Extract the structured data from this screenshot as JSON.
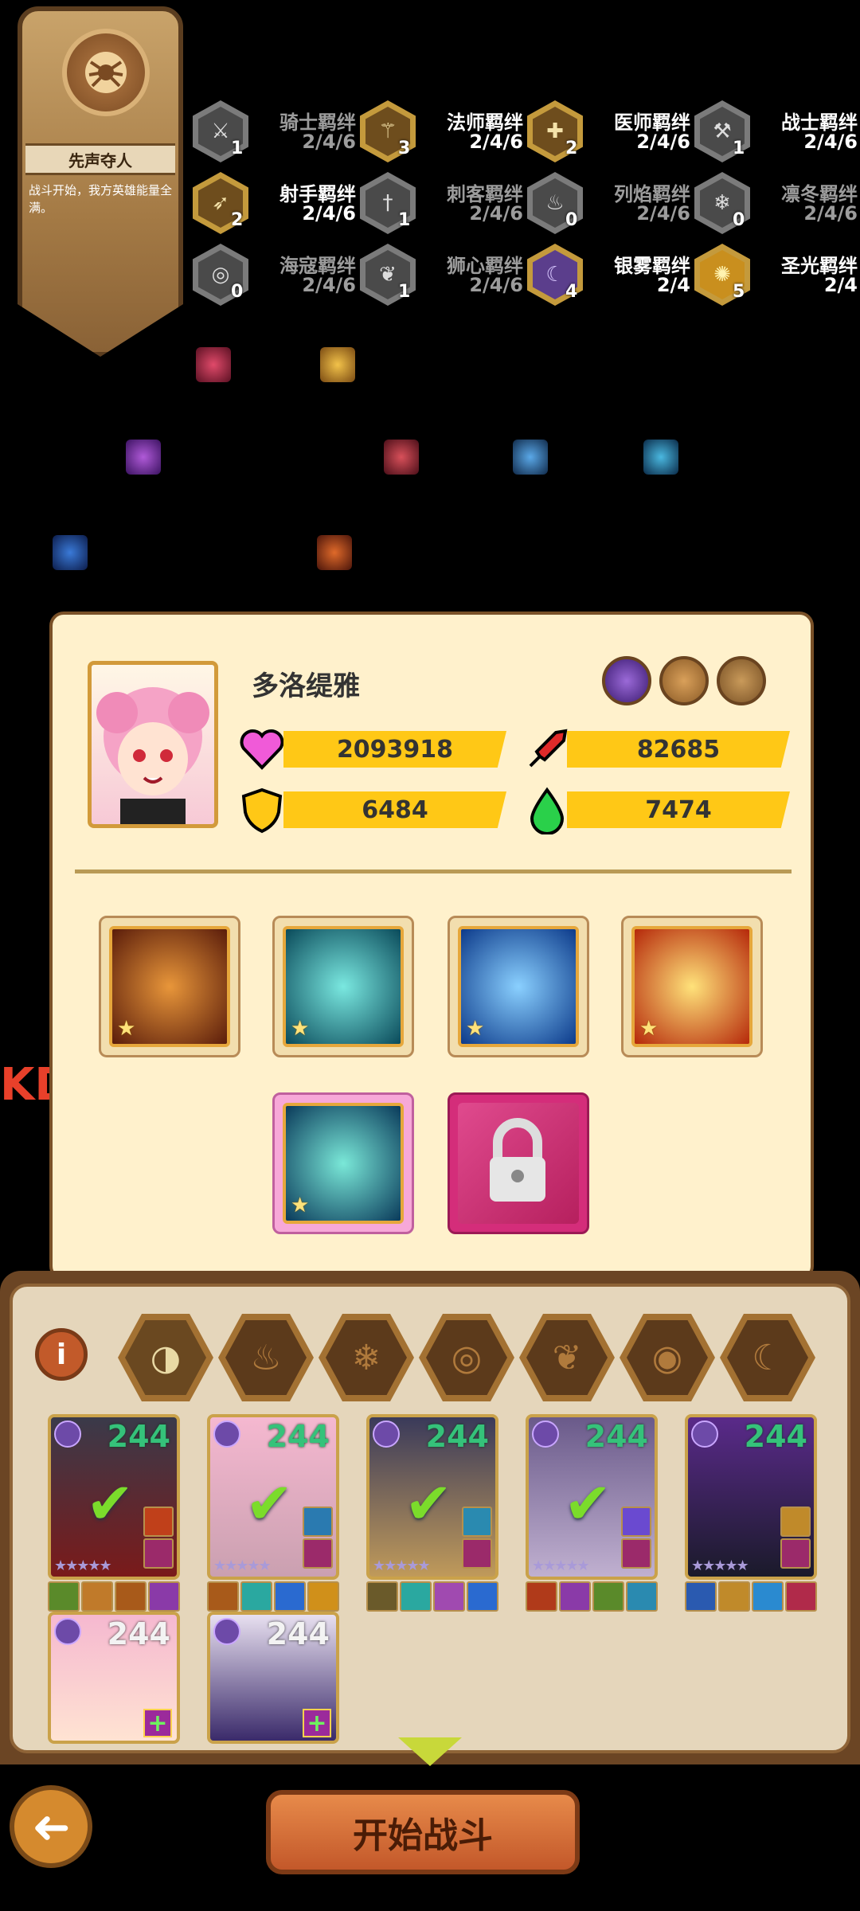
{
  "bond_card": {
    "title": "先声夺人",
    "description": "战斗开始，我方英雄能量全满。"
  },
  "bonds": [
    {
      "name": "骑士羁绊",
      "levels": "2/4/6",
      "count": "1",
      "active": false,
      "icon": "sword-icon"
    },
    {
      "name": "法师羁绊",
      "levels": "2/4/6",
      "count": "3",
      "active": true,
      "icon": "staff-icon"
    },
    {
      "name": "医师羁绊",
      "levels": "2/4/6",
      "count": "2",
      "active": true,
      "icon": "cross-icon"
    },
    {
      "name": "战士羁绊",
      "levels": "2/4/6",
      "count": "1",
      "active": true,
      "icon": "axe-icon"
    },
    {
      "name": "射手羁绊",
      "levels": "2/4/6",
      "count": "2",
      "active": true,
      "icon": "crossbow-icon"
    },
    {
      "name": "刺客羁绊",
      "levels": "2/4/6",
      "count": "1",
      "active": false,
      "icon": "dagger-icon"
    },
    {
      "name": "列焰羁绊",
      "levels": "2/4/6",
      "count": "0",
      "active": false,
      "icon": "flame-icon"
    },
    {
      "name": "凛冬羁绊",
      "levels": "2/4/6",
      "count": "0",
      "active": false,
      "icon": "snowflake-icon"
    },
    {
      "name": "海寇羁绊",
      "levels": "2/4/6",
      "count": "0",
      "active": false,
      "icon": "wave-icon"
    },
    {
      "name": "狮心羁绊",
      "levels": "2/4/6",
      "count": "1",
      "active": false,
      "icon": "leaf-icon"
    },
    {
      "name": "银雾羁绊",
      "levels": "2/4",
      "count": "4",
      "active": true,
      "icon": "mist-icon"
    },
    {
      "name": "圣光羁绊",
      "levels": "2/4",
      "count": "5",
      "active": true,
      "icon": "holy-icon"
    }
  ],
  "hero": {
    "name": "多洛缇雅",
    "hp": "2093918",
    "attack": "82685",
    "defense": "6484",
    "speed": "7474"
  },
  "filters": [
    "all",
    "fire",
    "ice",
    "wave",
    "leaf",
    "eye",
    "moon"
  ],
  "roster": [
    {
      "level": "244",
      "selected": true
    },
    {
      "level": "244",
      "selected": true
    },
    {
      "level": "244",
      "selected": true
    },
    {
      "level": "244",
      "selected": true
    },
    {
      "level": "244",
      "selected": false
    },
    {
      "level": "244",
      "selected": false
    },
    {
      "level": "244",
      "selected": false
    }
  ],
  "side_text": "KD",
  "start_button": "开始战斗",
  "colors": {
    "accent_gold": "#ffc816",
    "panel": "#fff1cc",
    "level_green": "#35c27a"
  }
}
